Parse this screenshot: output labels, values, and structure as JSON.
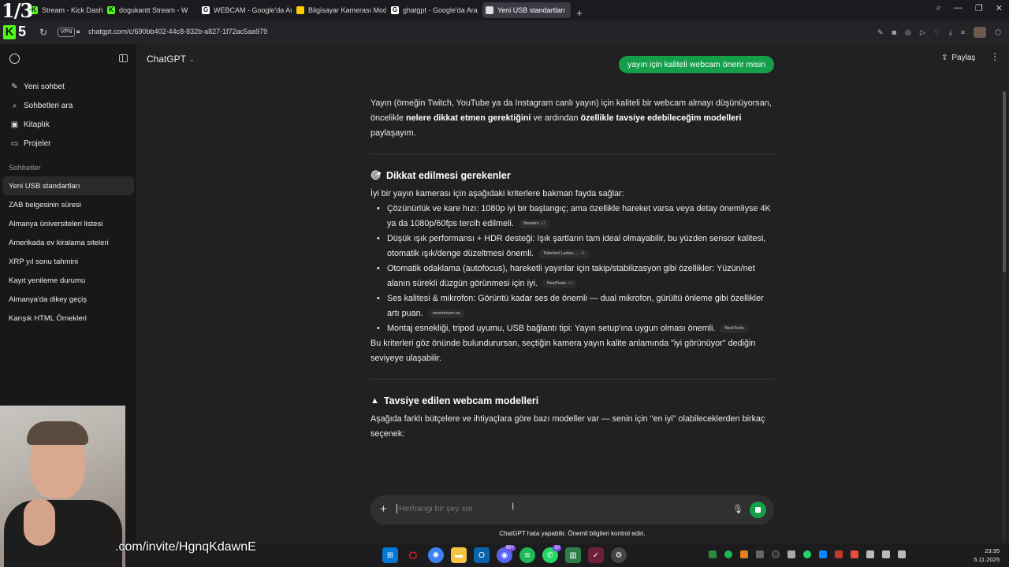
{
  "overlay": {
    "fraction": "1/3",
    "invite": ".com/invite/HgnqKdawnE"
  },
  "browser": {
    "tabs": [
      {
        "label": "Stream - Kick Dashboard",
        "fav_color": "#53fc18",
        "fav": "K"
      },
      {
        "label": "dogukantt Stream - W",
        "fav_color": "#53fc18",
        "fav": "K"
      },
      {
        "label": "WEBCAM - Google'da Ara",
        "fav_color": "#ffffff",
        "fav": "G"
      },
      {
        "label": "Bilgisayar Kamerası Model",
        "fav_color": "#ffcc00",
        "fav": ""
      },
      {
        "label": "ghatgpt - Google'da Ara",
        "fav_color": "#ffffff",
        "fav": "G"
      },
      {
        "label": "Yeni USB standartları",
        "fav_color": "#dddddd",
        "fav": ""
      }
    ],
    "url": "chatgpt.com/c/690bb402-44c8-832b-a827-1f72ac5aa979",
    "vpn": "VPN",
    "k_count": "5"
  },
  "sidebar": {
    "nav": [
      {
        "label": "Yeni sohbet",
        "icon": "✎"
      },
      {
        "label": "Sohbetleri ara",
        "icon": "⌕"
      },
      {
        "label": "Kitaplık",
        "icon": "▣"
      },
      {
        "label": "Projeler",
        "icon": "▭"
      }
    ],
    "section": "Sohbetler",
    "chats": [
      "Yeni USB standartları",
      "ZAB belgesinin süresi",
      "Almanya üniversiteleri listesi",
      "Amerikada ev kiralama siteleri",
      "XRP yıl sonu tahmini",
      "Kayıt yenileme durumu",
      "Almanya'da dikey geçiş",
      "Karışık HTML Örnekleri"
    ]
  },
  "header": {
    "model": "ChatGPT",
    "share": "Paylaş"
  },
  "user_message": "yayın için kaliteli webcam önerir misin",
  "answer": {
    "intro_1": "Yayın (örneğin Twitch, YouTube ya da Instagram canlı yayın) için kaliteli bir webcam almayı düşünüyorsan, öncelikle ",
    "intro_b1": "nelere dikkat etmen gerektiğini",
    "intro_2": " ve ardından ",
    "intro_b2": "özellikle tavsiye edebileceğim modelleri",
    "intro_3": " paylaşayım.",
    "section1_title": "Dikkat edilmesi gerekenler",
    "section1_lead": "İyi bir yayın kamerası için aşağıdaki kriterlere bakman fayda sağlar:",
    "criteria": [
      {
        "text": "Çözünürlük ve kare hızı: 1080p iyi bir başlangıç; ama özellikle hareket varsa veya detay önemliyse 4K ya da 1080p/60fps tercih edilmeli.",
        "chip": "9meters",
        "chip_n": "+2"
      },
      {
        "text": "Düşük ışık performansı + HDR desteği: Işık şartların tam ideal olmayabilir, bu yüzden sensor kalitesi, otomatik ışık/denge düzeltmesi önemli.",
        "chip": "Talented Ladies ...",
        "chip_n": "+1"
      },
      {
        "text": "Otomatik odaklama (autofocus), hareketli yayınlar için takip/stabilizasyon gibi özellikler: Yüzün/net alanın sürekli düzgün görünmesi için iyi.",
        "chip": "NextTools",
        "chip_n": "+1"
      },
      {
        "text": "Ses kalitesi & mikrofon: Görüntü kadar ses de önemli — dual mikrofon, gürültü önleme gibi özellikler artı puan.",
        "chip": "nearstream.us",
        "chip_n": ""
      },
      {
        "text": "Montaj esnekliği, tripod uyumu, USB bağlantı tipi: Yayın setup'ına uygun olması önemli.",
        "chip": "NextTools",
        "chip_n": ""
      }
    ],
    "section1_outro": "Bu kriterleri göz önünde bulundurursan, seçtiğin kamera yayın kalite anlamında \"iyi görünüyor\" dediğin seviyeye ulaşabilir.",
    "section2_title": "Tavsiye edilen webcam modelleri",
    "section2_lead": "Aşağıda farklı bütçelere ve ihtiyaçlara göre bazı modeller var — senin için \"en iyi\" olabileceklerden birkaç seçenek:"
  },
  "composer": {
    "placeholder": "Herhangi bir şey sor"
  },
  "disclaimer": "ChatGPT hata yapabilir. Önemli bilgileri kontrol edin.",
  "taskbar": {
    "badges": {
      "opera": "99+",
      "whatsapp": "50"
    },
    "time": "23:35",
    "date": "5.11.2025"
  }
}
